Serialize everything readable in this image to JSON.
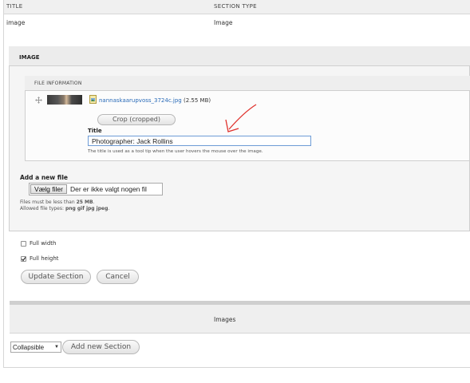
{
  "table": {
    "headers": [
      "TITLE",
      "SECTION TYPE"
    ],
    "row": {
      "title": "image",
      "section_type": "Image"
    }
  },
  "image_panel": {
    "title": "IMAGE",
    "file_information": {
      "heading": "FILE INFORMATION",
      "file_name": "nannaskaarupvoss_3724c.jpg",
      "file_size": "(2.55 MB)",
      "crop_button": "Crop (cropped)",
      "title_label": "Title",
      "title_value": "Photographer: Jack Rollins",
      "title_help": "The title is used as a tool tip when the user hovers the mouse over the image."
    },
    "add_file": {
      "label": "Add a new file",
      "choose_button": "Vælg filer",
      "no_file_text": "Der er ikke valgt nogen fil",
      "limit_prefix": "Files must be less than ",
      "limit_value": "25 MB",
      "limit_suffix": ".",
      "types_prefix": "Allowed file types: ",
      "types_value": "png gif jpg jpeg",
      "types_suffix": "."
    }
  },
  "options": {
    "full_width": {
      "label": "Full width",
      "checked": false
    },
    "full_height": {
      "label": "Full height",
      "checked": true
    }
  },
  "buttons": {
    "update": "Update Section",
    "cancel": "Cancel",
    "add": "Add new Section"
  },
  "images_bar": {
    "label": "Images"
  },
  "footer": {
    "select_value": "Collapsible"
  },
  "colors": {
    "link": "#2a6bb8",
    "arrow": "#e0322d",
    "focus_border": "#6e9cd6"
  }
}
